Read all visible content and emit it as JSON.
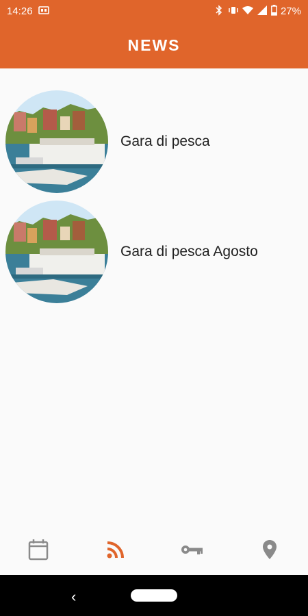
{
  "status": {
    "time": "14:26",
    "battery": "27%"
  },
  "app": {
    "title": "NEWS",
    "accent": "#e0652b"
  },
  "news": [
    {
      "title": "Gara di pesca"
    },
    {
      "title": "Gara di pesca Agosto"
    }
  ],
  "bottom_nav": {
    "active": "news",
    "items": [
      "calendar-icon",
      "rss-icon",
      "key-icon",
      "location-icon"
    ]
  },
  "system_nav": {
    "back": "‹"
  }
}
